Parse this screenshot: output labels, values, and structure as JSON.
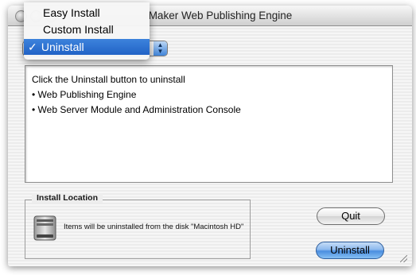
{
  "window": {
    "title_visible": "Maker Web Publishing Engine"
  },
  "install_type_menu": {
    "items": [
      "Easy Install",
      "Custom Install",
      "Uninstall"
    ],
    "selected": "Uninstall",
    "checkmark": "✓"
  },
  "info_box": {
    "intro": "Click the Uninstall button to uninstall",
    "items": [
      "Web Publishing Engine",
      "Web Server Module and Administration Console"
    ]
  },
  "install_location": {
    "label": "Install Location",
    "message": "Items will be uninstalled from the disk \"Macintosh HD\""
  },
  "buttons": {
    "quit": "Quit",
    "uninstall": "Uninstall"
  },
  "colors": {
    "selection": "#2163c6",
    "default_button": "#4a8ee0"
  }
}
